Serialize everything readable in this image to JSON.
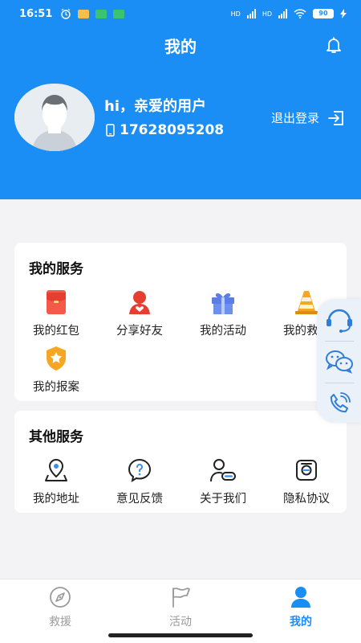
{
  "status_bar": {
    "time": "16:51",
    "network_1": "HD",
    "network_2": "HD",
    "battery": "90",
    "icons": [
      "alarm-icon",
      "message-icon",
      "app-icon-green",
      "app-icon-green"
    ]
  },
  "header": {
    "title": "我的",
    "greeting": "hi，亲爱的用户",
    "phone": "17628095208",
    "logout_label": "退出登录",
    "background_color": "#1a8ef5"
  },
  "my_services": {
    "title": "我的服务",
    "items": [
      {
        "label": "我的红包",
        "icon": "red-envelope-icon"
      },
      {
        "label": "分享好友",
        "icon": "share-friend-icon"
      },
      {
        "label": "我的活动",
        "icon": "gift-icon"
      },
      {
        "label": "我的救援",
        "icon": "traffic-cone-icon"
      },
      {
        "label": "我的报案",
        "icon": "police-badge-icon"
      }
    ]
  },
  "other_services": {
    "title": "其他服务",
    "items": [
      {
        "label": "我的地址",
        "icon": "location-icon"
      },
      {
        "label": "意见反馈",
        "icon": "feedback-icon"
      },
      {
        "label": "关于我们",
        "icon": "about-us-icon"
      },
      {
        "label": "隐私协议",
        "icon": "privacy-icon"
      }
    ]
  },
  "floating_panel": {
    "buttons": [
      "customer-service-icon",
      "wechat-icon",
      "phone-call-icon"
    ]
  },
  "tabbar": {
    "tabs": [
      {
        "label": "救援",
        "icon": "compass-icon",
        "active": false
      },
      {
        "label": "活动",
        "icon": "flag-icon",
        "active": false
      },
      {
        "label": "我的",
        "icon": "person-icon",
        "active": true
      }
    ],
    "active_color": "#1a8ef5"
  }
}
